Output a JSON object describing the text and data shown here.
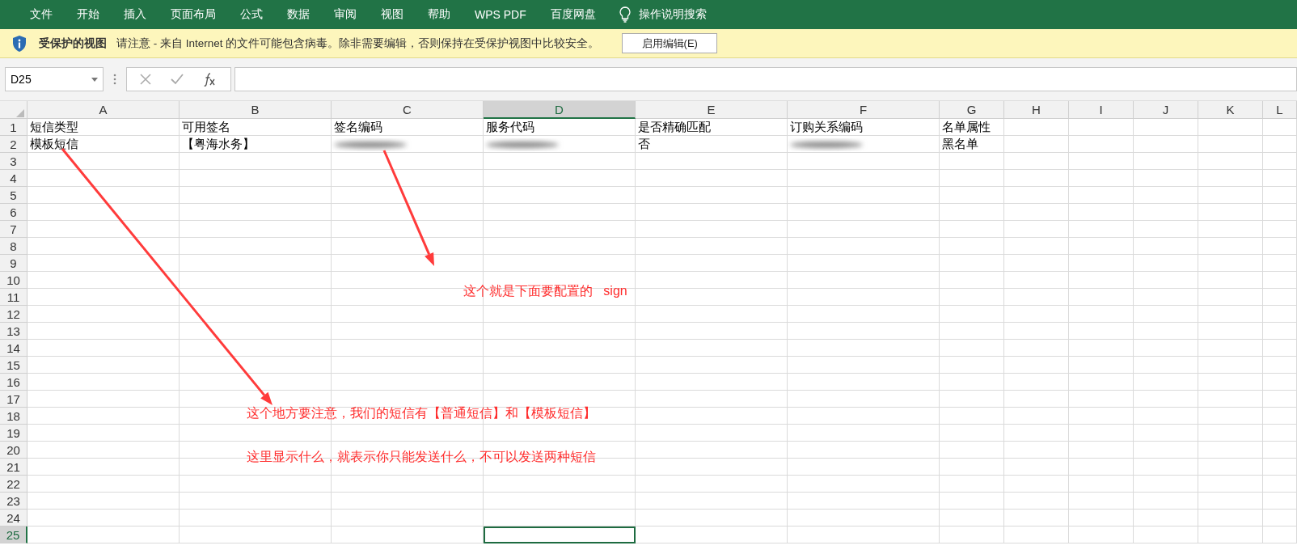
{
  "menu": {
    "items": [
      {
        "label": "文件"
      },
      {
        "label": "开始"
      },
      {
        "label": "插入"
      },
      {
        "label": "页面布局"
      },
      {
        "label": "公式"
      },
      {
        "label": "数据"
      },
      {
        "label": "审阅"
      },
      {
        "label": "视图"
      },
      {
        "label": "帮助"
      },
      {
        "label": "WPS PDF"
      },
      {
        "label": "百度网盘"
      }
    ],
    "tell_me": "操作说明搜索"
  },
  "protected_view": {
    "title": "受保护的视图",
    "message": "请注意 - 来自 Internet 的文件可能包含病毒。除非需要编辑，否则保持在受保护视图中比较安全。",
    "button": "启用编辑(E)"
  },
  "formula_bar": {
    "name_box": "D25"
  },
  "columns": [
    {
      "label": "A",
      "selected": false
    },
    {
      "label": "B",
      "selected": false
    },
    {
      "label": "C",
      "selected": false
    },
    {
      "label": "D",
      "selected": true
    },
    {
      "label": "E",
      "selected": false
    },
    {
      "label": "F",
      "selected": false
    },
    {
      "label": "G",
      "selected": false
    },
    {
      "label": "H",
      "selected": false
    },
    {
      "label": "I",
      "selected": false
    },
    {
      "label": "J",
      "selected": false
    },
    {
      "label": "K",
      "selected": false
    },
    {
      "label": "L",
      "selected": false
    }
  ],
  "rows": [
    {
      "header": "1",
      "selected": false,
      "cells": [
        {
          "text": "短信类型"
        },
        {
          "text": "可用签名"
        },
        {
          "text": "签名编码"
        },
        {
          "text": "服务代码"
        },
        {
          "text": "是否精确匹配"
        },
        {
          "text": "订购关系编码"
        },
        {
          "text": "名单属性"
        }
      ]
    },
    {
      "header": "2",
      "selected": false,
      "cells": [
        {
          "text": "模板短信"
        },
        {
          "text": "【粤海水务】"
        },
        {
          "redacted": true
        },
        {
          "redacted": true
        },
        {
          "text": "否"
        },
        {
          "redacted": true
        },
        {
          "text": "黑名单"
        }
      ]
    },
    {
      "header": "3",
      "selected": false
    },
    {
      "header": "4",
      "selected": false
    },
    {
      "header": "5",
      "selected": false
    },
    {
      "header": "6",
      "selected": false
    },
    {
      "header": "7",
      "selected": false
    },
    {
      "header": "8",
      "selected": false
    },
    {
      "header": "9",
      "selected": false
    },
    {
      "header": "10",
      "selected": false
    },
    {
      "header": "11",
      "selected": false
    },
    {
      "header": "12",
      "selected": false
    },
    {
      "header": "13",
      "selected": false
    },
    {
      "header": "14",
      "selected": false
    },
    {
      "header": "15",
      "selected": false
    },
    {
      "header": "16",
      "selected": false
    },
    {
      "header": "17",
      "selected": false
    },
    {
      "header": "18",
      "selected": false
    },
    {
      "header": "19",
      "selected": false
    },
    {
      "header": "20",
      "selected": false
    },
    {
      "header": "21",
      "selected": false
    },
    {
      "header": "22",
      "selected": false
    },
    {
      "header": "23",
      "selected": false
    },
    {
      "header": "24",
      "selected": false
    },
    {
      "header": "25",
      "selected": true
    }
  ],
  "annotations": [
    {
      "text": "这个就是下面要配置的   sign"
    },
    {
      "text": "这个地方要注意，我们的短信有【普通短信】和【模板短信】"
    },
    {
      "text": "这里显示什么，就表示你只能发送什么，不可以发送两种短信"
    }
  ]
}
